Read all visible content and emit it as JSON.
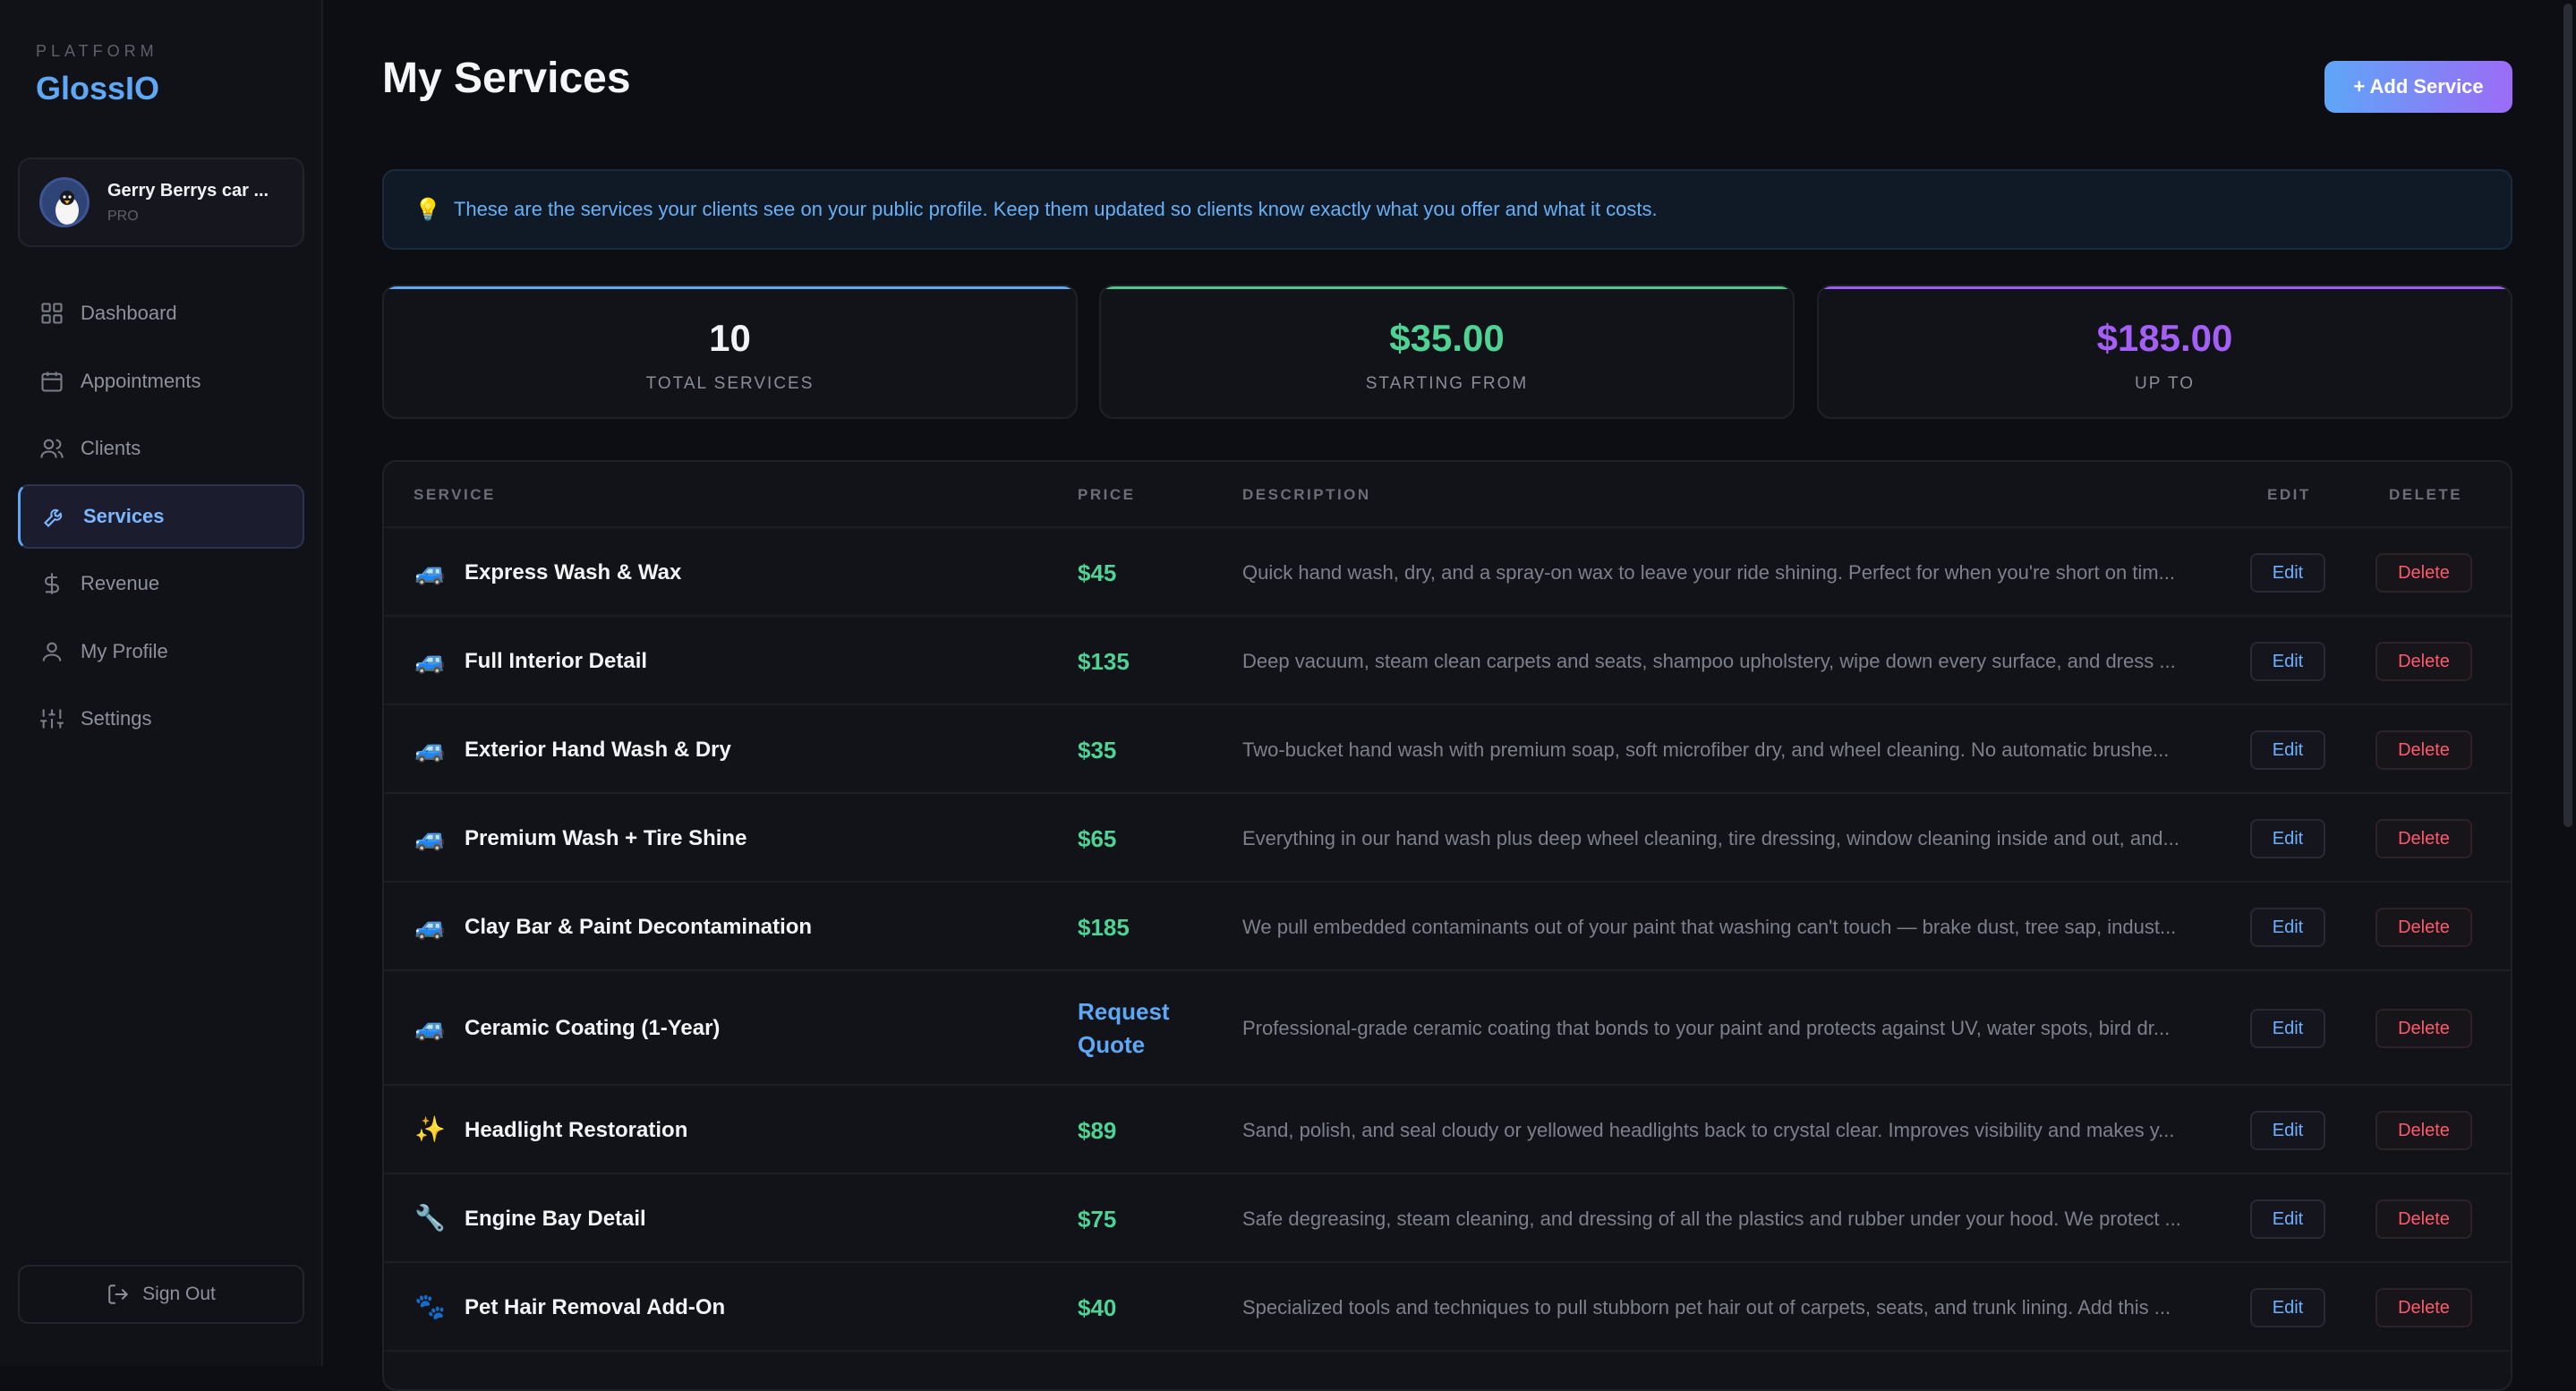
{
  "sidebar": {
    "kicker": "PLATFORM",
    "brand": "GlossIO",
    "profile": {
      "name": "Gerry Berrys car ...",
      "tier": "PRO"
    },
    "items": [
      {
        "label": "Dashboard",
        "icon": "grid-icon"
      },
      {
        "label": "Appointments",
        "icon": "calendar-icon"
      },
      {
        "label": "Clients",
        "icon": "users-icon"
      },
      {
        "label": "Services",
        "icon": "wrench-icon",
        "active": true
      },
      {
        "label": "Revenue",
        "icon": "dollar-icon"
      },
      {
        "label": "My Profile",
        "icon": "user-icon"
      },
      {
        "label": "Settings",
        "icon": "sliders-icon"
      }
    ],
    "signout": "Sign Out"
  },
  "header": {
    "title": "My Services",
    "add_button": "+ Add Service"
  },
  "banner": {
    "icon": "💡",
    "text": "These are the services your clients see on your public profile. Keep them updated so clients know exactly what you offer and what it costs."
  },
  "stats": [
    {
      "value": "10",
      "label": "TOTAL SERVICES",
      "color": "#f1f2f6"
    },
    {
      "value": "$35.00",
      "label": "STARTING FROM",
      "color": "#4fd394"
    },
    {
      "value": "$185.00",
      "label": "UP TO",
      "color": "#a35ff6"
    }
  ],
  "table": {
    "headers": {
      "service": "SERVICE",
      "price": "PRICE",
      "description": "DESCRIPTION",
      "edit": "EDIT",
      "delete": "DELETE"
    },
    "edit_label": "Edit",
    "delete_label": "Delete",
    "rows": [
      {
        "emoji": "🚙",
        "name": "Express Wash & Wax",
        "price": "$45",
        "description": "Quick hand wash, dry, and a spray-on wax to leave your ride shining. Perfect for when you're short on tim..."
      },
      {
        "emoji": "🚙",
        "name": "Full Interior Detail",
        "price": "$135",
        "description": "Deep vacuum, steam clean carpets and seats, shampoo upholstery, wipe down every surface, and dress ..."
      },
      {
        "emoji": "🚙",
        "name": "Exterior Hand Wash & Dry",
        "price": "$35",
        "description": "Two-bucket hand wash with premium soap, soft microfiber dry, and wheel cleaning. No automatic brushe..."
      },
      {
        "emoji": "🚙",
        "name": "Premium Wash + Tire Shine",
        "price": "$65",
        "description": "Everything in our hand wash plus deep wheel cleaning, tire dressing, window cleaning inside and out, and..."
      },
      {
        "emoji": "🚙",
        "name": "Clay Bar & Paint Decontamination",
        "price": "$185",
        "description": "We pull embedded contaminants out of your paint that washing can't touch — brake dust, tree sap, indust..."
      },
      {
        "emoji": "🚙",
        "name": "Ceramic Coating (1-Year)",
        "price": "Request Quote",
        "quote": true,
        "description": "Professional-grade ceramic coating that bonds to your paint and protects against UV, water spots, bird dr..."
      },
      {
        "emoji": "✨",
        "name": "Headlight Restoration",
        "price": "$89",
        "description": "Sand, polish, and seal cloudy or yellowed headlights back to crystal clear. Improves visibility and makes y..."
      },
      {
        "emoji": "🔧",
        "name": "Engine Bay Detail",
        "price": "$75",
        "description": "Safe degreasing, steam cleaning, and dressing of all the plastics and rubber under your hood. We protect ..."
      },
      {
        "emoji": "🐾",
        "name": "Pet Hair Removal Add-On",
        "price": "$40",
        "description": "Specialized tools and techniques to pull stubborn pet hair out of carpets, seats, and trunk lining. Add this ..."
      }
    ]
  }
}
